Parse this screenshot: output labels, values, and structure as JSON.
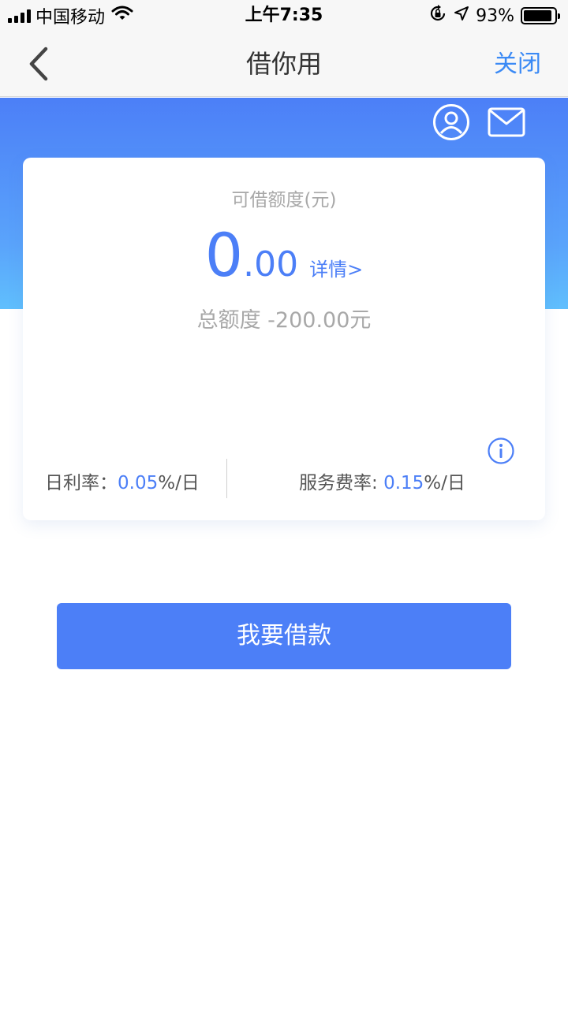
{
  "status_bar": {
    "carrier": "中国移动",
    "time": "上午7:35",
    "battery_text": "93%",
    "battery_level": 0.93,
    "icons": [
      "signal-icon",
      "wifi-icon",
      "rotation-lock-icon",
      "location-icon",
      "battery-icon"
    ]
  },
  "nav": {
    "back_icon": "chevron-left-icon",
    "title": "借你用",
    "close_label": "关闭"
  },
  "header_icons": [
    "user-icon",
    "mail-icon"
  ],
  "card": {
    "label": "可借额度(元)",
    "amount_int": "0",
    "amount_dec": ".00",
    "detail_link": "详情>",
    "total": "总额度 -200.00元",
    "info_icon": "info-icon",
    "daily_rate": {
      "label": "日利率：",
      "value": "0.05",
      "unit": "%/日"
    },
    "service_rate": {
      "label": "服务费率: ",
      "value": "0.15",
      "unit": "%/日"
    }
  },
  "borrow_button": "我要借款",
  "colors": {
    "primary": "#4c7ff7",
    "link": "#3b8af5",
    "header_gradient_start": "#4c7ff7",
    "header_gradient_end": "#60bffd",
    "muted_text": "#a8a8a8"
  }
}
